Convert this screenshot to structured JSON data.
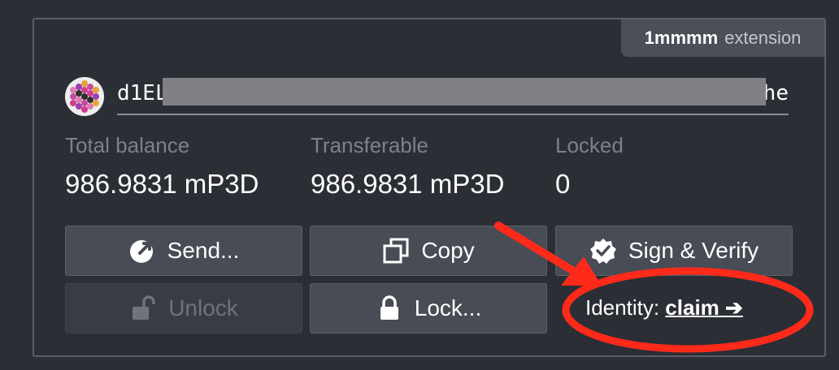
{
  "extension_tab": {
    "name": "1mmmm",
    "kind": "extension"
  },
  "account": {
    "address": "d1EL…Zwhe",
    "address_visible_start": "d1EL",
    "address_visible_end": "Zwhe",
    "identicon": "polkadot-identicon"
  },
  "balances": {
    "total_label": "Total balance",
    "total_value": "986.9831 mP3D",
    "transferable_label": "Transferable",
    "transferable_value": "986.9831 mP3D",
    "locked_label": "Locked",
    "locked_value": "0"
  },
  "actions": {
    "send": {
      "label": "Send...",
      "icon": "send-icon"
    },
    "copy": {
      "label": "Copy",
      "icon": "copy-icon"
    },
    "sign": {
      "label": "Sign & Verify",
      "icon": "verified-badge-icon"
    },
    "unlock": {
      "label": "Unlock",
      "icon": "unlock-icon",
      "disabled": true
    },
    "lock": {
      "label": "Lock...",
      "icon": "lock-icon"
    }
  },
  "identity": {
    "label": "Identity:",
    "link": "claim ➔"
  },
  "colors": {
    "background": "#2b2e35",
    "button": "#474c55",
    "annotation_red": "#ff2a1a"
  }
}
